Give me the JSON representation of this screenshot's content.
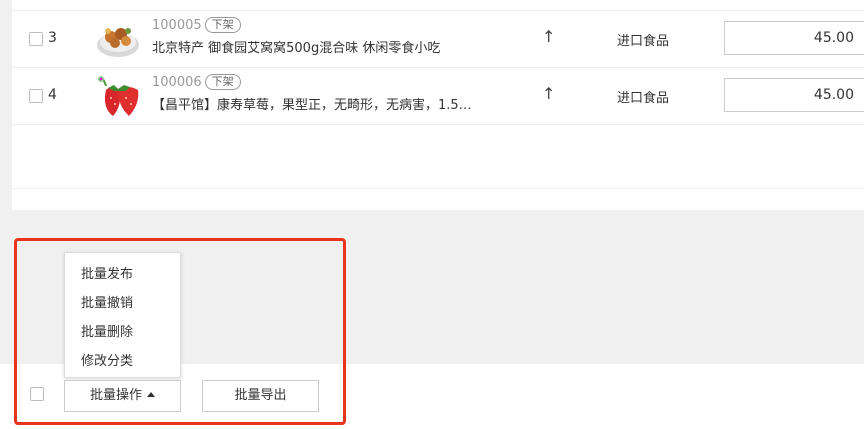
{
  "products": [
    {
      "index": "3",
      "id": "100005",
      "status": "下架",
      "name": "北京特产 御食园艾窝窝500g混合味 休闲零食小吃",
      "sort_icon": "↑",
      "category": "进口食品",
      "price": "45.00",
      "thumb_icon": "snack-thumbnail"
    },
    {
      "index": "4",
      "id": "100006",
      "status": "下架",
      "name": "【昌平馆】康寿草莓，果型正，无畸形，无病害，1.5…",
      "sort_icon": "↑",
      "category": "进口食品",
      "price": "45.00",
      "thumb_icon": "strawberry-thumbnail"
    }
  ],
  "batch_menu": {
    "items": [
      "批量发布",
      "批量撤销",
      "批量删除",
      "修改分类"
    ]
  },
  "footer": {
    "batch_button": "批量操作",
    "export_button": "批量导出"
  },
  "colors": {
    "highlight_border": "#e8341d",
    "page_background": "#f0f0f0"
  }
}
